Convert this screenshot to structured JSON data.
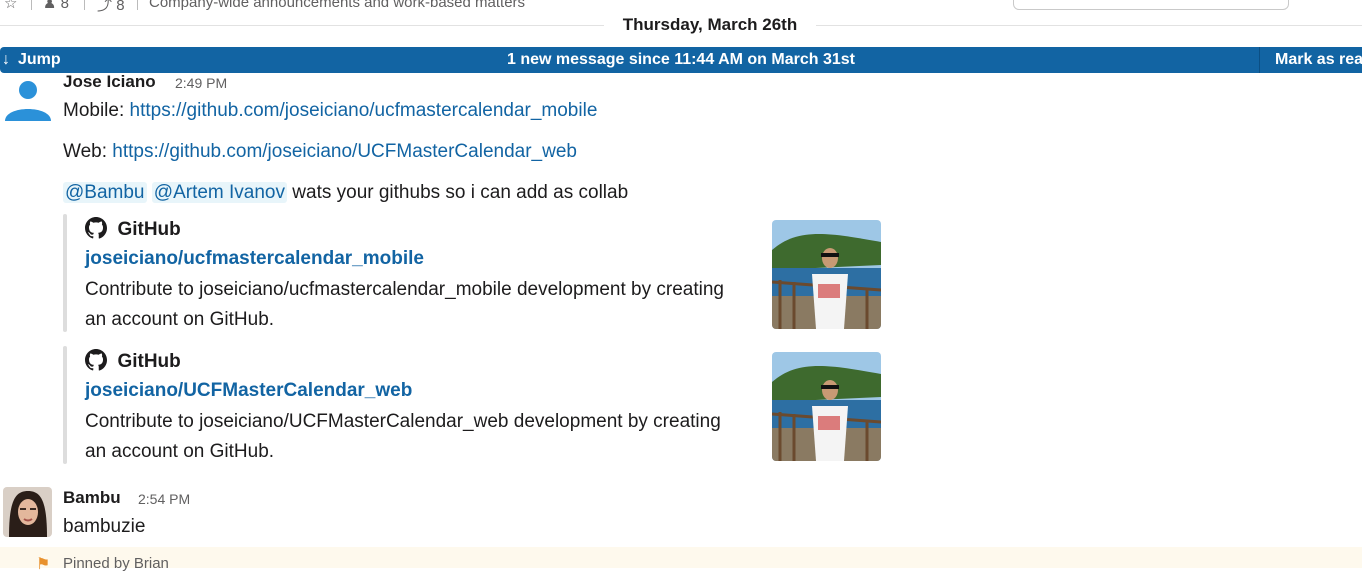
{
  "header": {
    "members_count": "8",
    "pins_count": "8",
    "channel_topic": "Company-wide announcements and work-based matters"
  },
  "day_divider": "Thursday, March 26th",
  "banner": {
    "jump_label": "Jump",
    "new_message_text": "1 new message since 11:44 AM on March 31st",
    "mark_read_label": "Mark as read"
  },
  "messages": [
    {
      "author": "Jose Iciano",
      "time": "2:49 PM",
      "mobile_label": "Mobile:",
      "mobile_url": "https://github.com/joseiciano/ucfmastercalendar_mobile",
      "web_label": "Web:",
      "web_url": "https://github.com/joseiciano/UCFMasterCalendar_web",
      "mention_1": "@Bambu",
      "mention_2": "@Artem Ivanov",
      "trailing_text": "wats your githubs so i can add as collab",
      "attachments": [
        {
          "service": "GitHub",
          "title": "joseiciano/ucfmastercalendar_mobile",
          "description": "Contribute to joseiciano/ucfmastercalendar_mobile development by creating an account on GitHub."
        },
        {
          "service": "GitHub",
          "title": "joseiciano/UCFMasterCalendar_web",
          "description": "Contribute to joseiciano/UCFMasterCalendar_web development by creating an account on GitHub."
        }
      ]
    },
    {
      "author": "Bambu",
      "time": "2:54 PM",
      "text": "bambuzie"
    }
  ],
  "pinned_text": "Pinned by Brian",
  "colors": {
    "banner": "#1264a3",
    "link": "#1264a3",
    "pinned_bg": "#fef9ed"
  }
}
